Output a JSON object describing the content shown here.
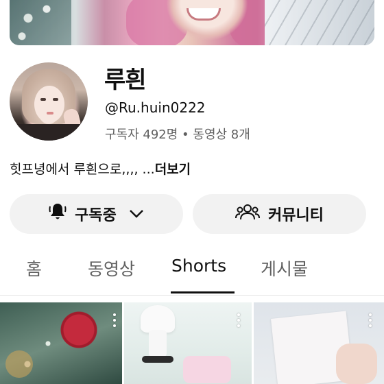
{
  "channel": {
    "name": "루흰",
    "handle": "@Ru.huin0222",
    "stats": "구독자 492명 • 동영상 8개",
    "description": "힛프녕에서 루흰으로,,,, ...",
    "more_label": "더보기"
  },
  "actions": {
    "subscribe_label": "구독중",
    "subscribe_icon": "bell-icon",
    "community_label": "커뮤니티",
    "community_icon": "people-icon"
  },
  "tabs": [
    {
      "label": "홈",
      "active": false
    },
    {
      "label": "동영상",
      "active": false
    },
    {
      "label": "Shorts",
      "active": true
    },
    {
      "label": "게시물",
      "active": false
    }
  ],
  "shorts": [
    {
      "id": "short-1"
    },
    {
      "id": "short-2"
    },
    {
      "id": "short-3"
    }
  ]
}
